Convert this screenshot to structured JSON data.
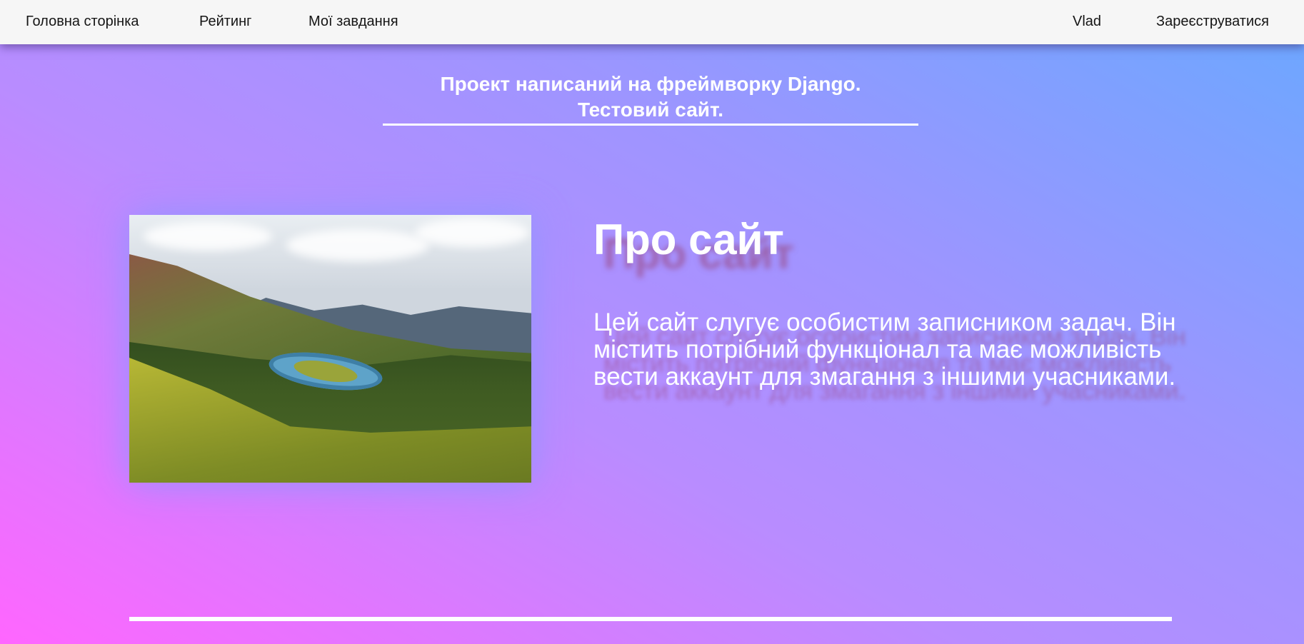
{
  "nav": {
    "home": "Головна сторінка",
    "rating": "Рейтинг",
    "tasks": "Мої завдання",
    "user": "Vlad",
    "register": "Зареєструватися"
  },
  "header": {
    "line1": "Проект написаний на фреймворку Django.",
    "line2": "Тестовий сайт."
  },
  "hero_image": {
    "icon": "landscape-photo",
    "subject": "mountain valley with lake"
  },
  "about": {
    "title": "Про сайт",
    "text": "Цей сайт слугує особистим записником задач. Він містить потрібний функціонал та має можливість вести аккаунт для змагання з іншими учасниками."
  },
  "colors": {
    "navbar_bg": "#f6f6f6",
    "gradient_start": "#ff66ff",
    "gradient_end": "#6aa8ff",
    "text": "#ffffff"
  }
}
